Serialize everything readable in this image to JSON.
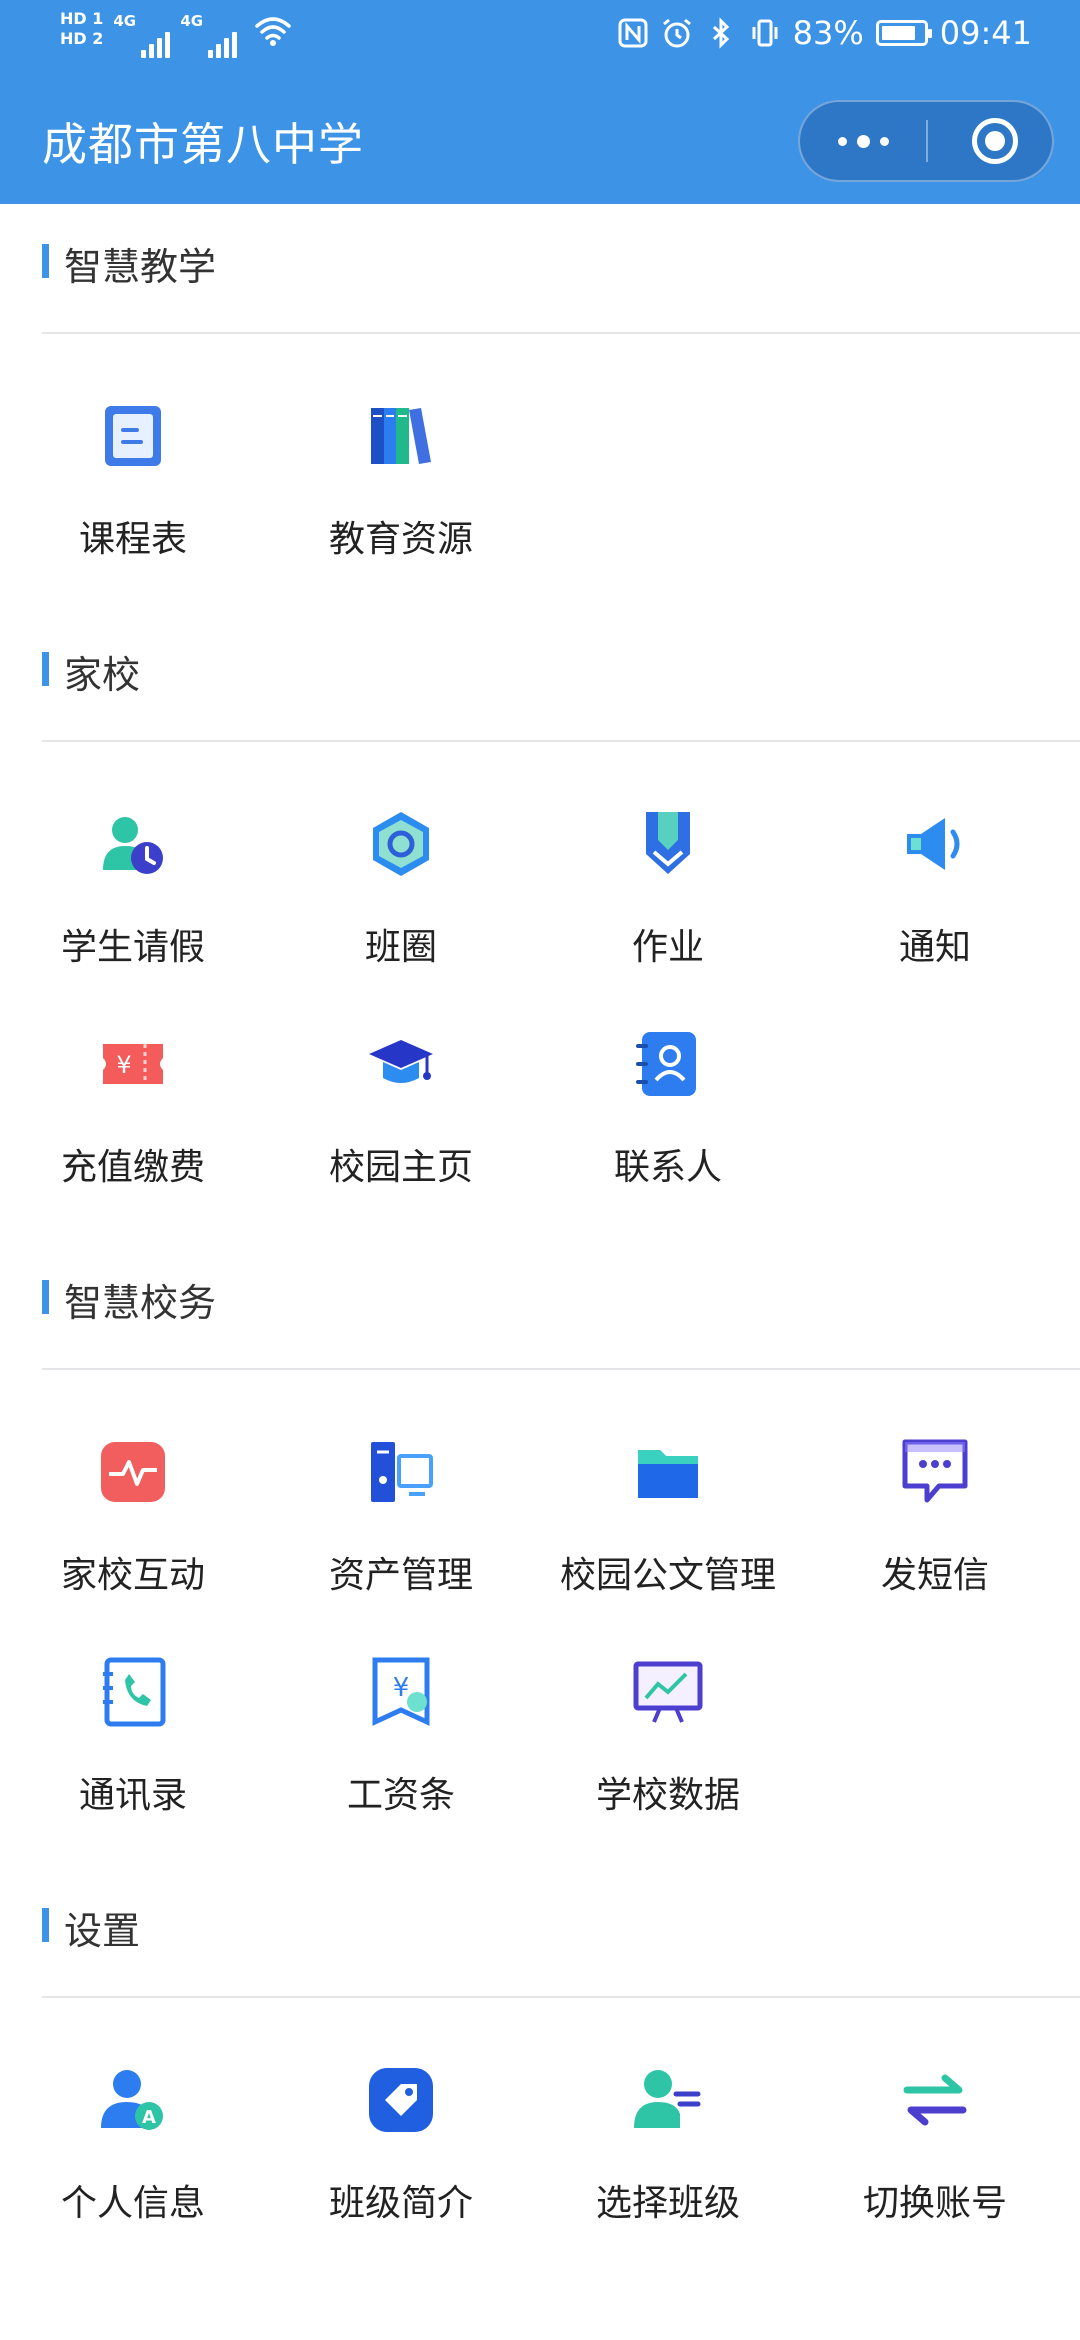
{
  "status_bar": {
    "hd1": "HD 1",
    "hd2": "HD 2",
    "sig1_tag": "4G",
    "sig2_tag": "4G",
    "battery": "83%",
    "battery_level": 0.83,
    "time": "09:41"
  },
  "header": {
    "title": "成都市第八中学",
    "more_icon": "more-dots-icon",
    "close_icon": "target-circle-icon",
    "color": "#3d93e6"
  },
  "sections": [
    {
      "title": "智慧教学",
      "items": [
        {
          "label": "课程表",
          "icon": "schedule-icon"
        },
        {
          "label": "教育资源",
          "icon": "books-icon"
        }
      ]
    },
    {
      "title": "家校",
      "items": [
        {
          "label": "学生请假",
          "icon": "leave-clock-icon"
        },
        {
          "label": "班圈",
          "icon": "hexagon-circle-icon"
        },
        {
          "label": "作业",
          "icon": "pencil-shield-icon"
        },
        {
          "label": "通知",
          "icon": "megaphone-icon"
        },
        {
          "label": "充值缴费",
          "icon": "ticket-yuan-icon"
        },
        {
          "label": "校园主页",
          "icon": "graduation-cap-icon"
        },
        {
          "label": "联系人",
          "icon": "contact-book-icon"
        }
      ]
    },
    {
      "title": "智慧校务",
      "items": [
        {
          "label": "家校互动",
          "icon": "heartbeat-icon"
        },
        {
          "label": "资产管理",
          "icon": "computer-tower-icon"
        },
        {
          "label": "校园公文管理",
          "icon": "folder-icon"
        },
        {
          "label": "发短信",
          "icon": "chat-bubble-icon"
        },
        {
          "label": "通讯录",
          "icon": "phone-book-icon"
        },
        {
          "label": "工资条",
          "icon": "yuan-receipt-icon"
        },
        {
          "label": "学校数据",
          "icon": "chart-board-icon"
        }
      ]
    },
    {
      "title": "设置",
      "items": [
        {
          "label": "个人信息",
          "icon": "user-a-icon"
        },
        {
          "label": "班级简介",
          "icon": "tag-icon"
        },
        {
          "label": "选择班级",
          "icon": "user-list-icon"
        },
        {
          "label": "切换账号",
          "icon": "swap-arrows-icon"
        }
      ]
    }
  ]
}
